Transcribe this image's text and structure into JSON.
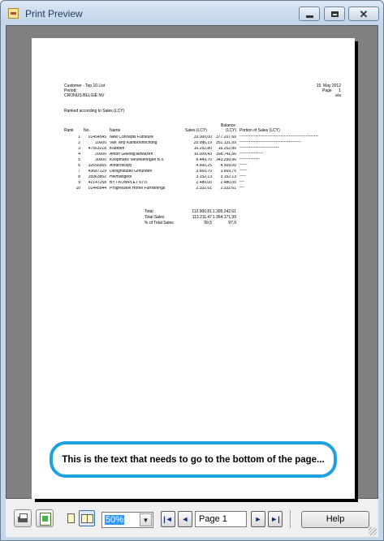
{
  "window": {
    "title": "Print Preview",
    "app_icon": "print-preview-icon"
  },
  "report": {
    "title": "Customer - Top 10 List",
    "period_label": "Period:",
    "company": "CRONUS BELGIË NV",
    "date": "15. May 2012",
    "page_label": "Page",
    "page_num": "1",
    "user": "a/a",
    "ranked_by": "Ranked according to Sales (LCY)",
    "headers": {
      "rank": "Rank",
      "no": "No.",
      "name": "Name",
      "sales": "Sales (LCY)",
      "balance_top": "Balance",
      "balance": "(LCY)",
      "portion": "Portion of Sales (LCY)"
    },
    "rows": [
      {
        "rank": "1",
        "no": "01454545",
        "name": "New Concepts Furniture",
        "sales": "33.000,00",
        "balance": "377.207,60",
        "bar": "**************************************************"
      },
      {
        "rank": "2",
        "no": "10000",
        "name": "Van Terp Kantoorinrichting",
        "sales": "25.996,19",
        "balance": "351.131,59",
        "bar": "***************************************"
      },
      {
        "rank": "3",
        "no": "47563218",
        "name": "Klubben",
        "sales": "16.252,80",
        "balance": "16.252,80",
        "bar": "*************************"
      },
      {
        "rank": "4",
        "no": "20000",
        "name": "Anton Geestig Adviezen",
        "sales": "10.009,43",
        "balance": "168.741,56",
        "bar": "***************"
      },
      {
        "rank": "5",
        "no": "30000",
        "name": "Koopmans Verzekeringen B.V.",
        "sales": "8.449,70",
        "balance": "343.299,96",
        "bar": "*************"
      },
      {
        "rank": "6",
        "no": "32656565",
        "name": "Antarcticopy",
        "sales": "4.600,25",
        "balance": "4.509,00",
        "bar": "*****"
      },
      {
        "rank": "7",
        "no": "43687129",
        "name": "Designstudio Gmunden",
        "sales": "3.669,70",
        "balance": "3.669,70",
        "bar": "*****"
      },
      {
        "rank": "8",
        "no": "35963852",
        "name": "Heimilisgedl",
        "sales": "3.152,13",
        "balance": "3.152,13",
        "bar": "****"
      },
      {
        "rank": "9",
        "no": "42147258",
        "name": "BYT-KOMPLET s.r.o.",
        "sales": "2.480,00",
        "balance": "2.480,00",
        "bar": "***"
      },
      {
        "rank": "10",
        "no": "01445544",
        "name": "Progressive Home Furnishings",
        "sales": "2.332,61",
        "balance": "2.332,61",
        "bar": "***"
      }
    ],
    "totals": {
      "total_label": "Total",
      "total_sales": "112.900,81",
      "total_balance": "1.305.242,61",
      "total_sales_label": "Total Sales",
      "all_sales": "113.211,47",
      "all_balance": "1.364.171,99",
      "pct_label": "% of Total Sales",
      "pct_sales": "99,5",
      "pct_balance": "97,9"
    }
  },
  "callout": {
    "text": "This is the text that needs to go to the bottom of the page...",
    "color": "#1ba1e2"
  },
  "toolbar": {
    "zoom_value": "50%",
    "page_value": "Page 1",
    "help_label": "Help",
    "first_glyph": "|◄",
    "prev_glyph": "◄",
    "next_glyph": "►",
    "last_glyph": "►|",
    "dropdown_glyph": "▼"
  }
}
